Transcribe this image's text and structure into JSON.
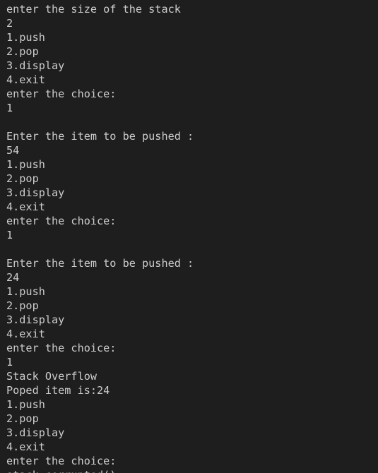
{
  "terminal": {
    "partial_top_text": "                                                         ",
    "lines": [
      "enter the size of the stack",
      "2",
      "1.push",
      "2.pop",
      "3.display",
      "4.exit",
      "enter the choice:",
      "1",
      "",
      "Enter the item to be pushed :",
      "54",
      "1.push",
      "2.pop",
      "3.display",
      "4.exit",
      "enter the choice:",
      "1",
      "",
      "Enter the item to be pushed :",
      "24",
      "1.push",
      "2.pop",
      "3.display",
      "4.exit",
      "enter the choice:",
      "1",
      "Stack Overflow",
      "Poped item is:24",
      "1.push",
      "2.pop",
      "3.display",
      "4.exit",
      "enter the choice:",
      "stack_corrupted()"
    ]
  }
}
